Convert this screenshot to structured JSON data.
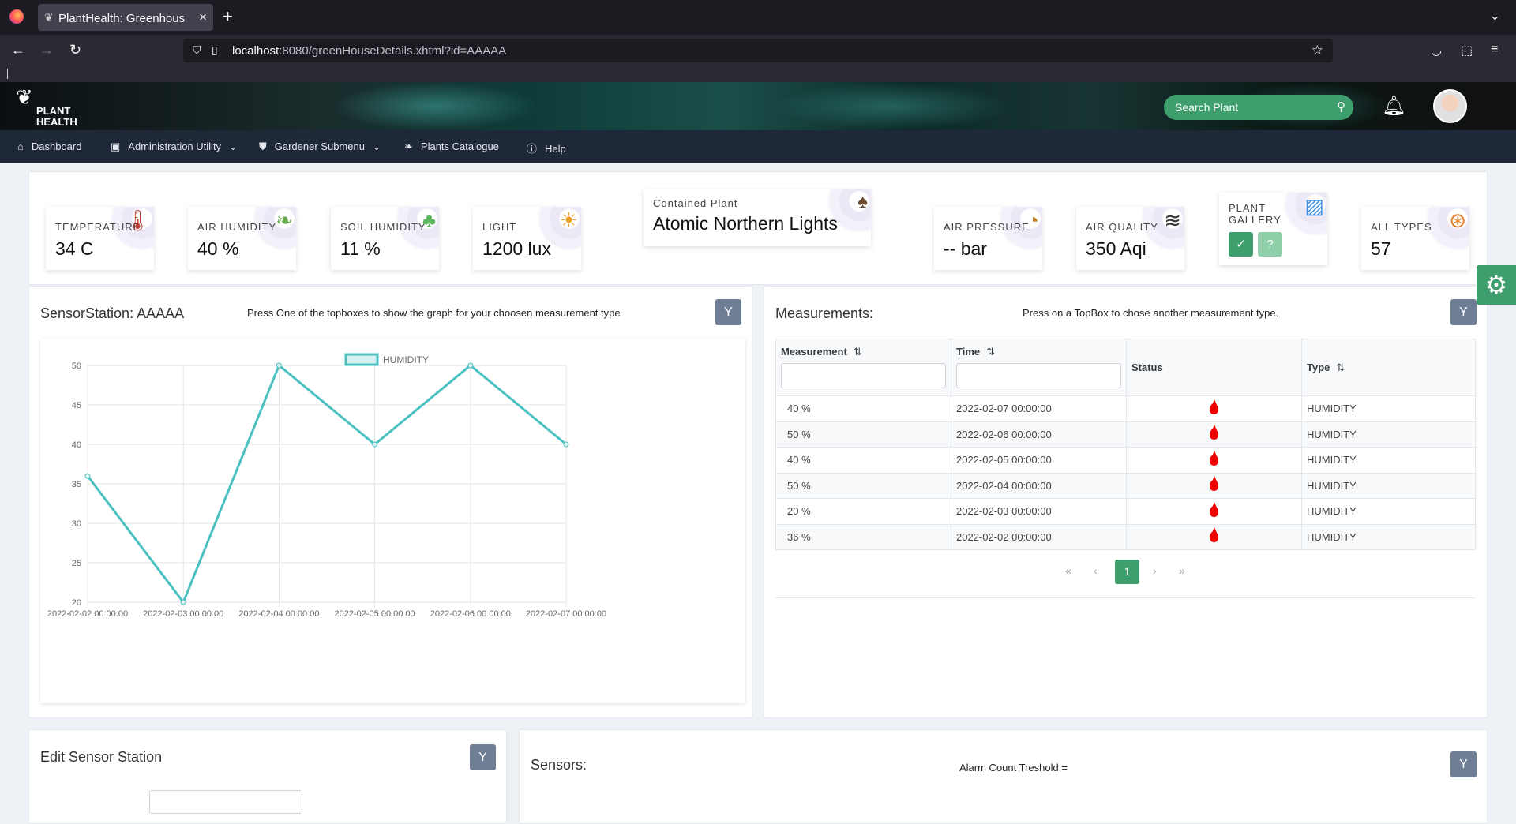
{
  "browser": {
    "tab_title": "PlantHealth: Greenhous",
    "url_host": "localhost",
    "url_rest": ":8080/greenHouseDetails.xhtml?id=AAAAA"
  },
  "header": {
    "logo_line1": "PLANT",
    "logo_line2": "HEALTH",
    "search_placeholder": "Search Plant"
  },
  "menu": {
    "items": [
      {
        "label": "Dashboard",
        "icon": "home-icon"
      },
      {
        "label": "Administration Utility",
        "icon": "briefcase-icon"
      },
      {
        "label": "Gardener Submenu",
        "icon": "shield-icon"
      },
      {
        "label": "Plants Catalogue",
        "icon": "leaf-icon"
      },
      {
        "label": "Help",
        "icon": "question-circle-icon"
      }
    ]
  },
  "topboxes": [
    {
      "label": "TEMPERATURE",
      "value": "34 C",
      "icon": "thermometer-icon"
    },
    {
      "label": "AIR HUMIDITY",
      "value": "40 %",
      "icon": "humid-leaf-icon"
    },
    {
      "label": "SOIL HUMIDITY",
      "value": "11 %",
      "icon": "watering-can-icon"
    },
    {
      "label": "LIGHT",
      "value": "1200 lux",
      "icon": "sun-icon"
    },
    {
      "label": "Contained Plant",
      "value": "Atomic Northern Lights",
      "icon": "potted-plant-icon"
    },
    {
      "label": "AIR PRESSURE",
      "value": "-- bar",
      "icon": "gauge-icon"
    },
    {
      "label": "AIR QUALITY",
      "value": "350 Aqi",
      "icon": "wind-icon"
    },
    {
      "label": "PLANT GALLERY",
      "value": "",
      "icon": "picture-icon"
    },
    {
      "label": "ALL TYPES",
      "value": "57",
      "icon": "globe-icon"
    }
  ],
  "gallery_buttons": {
    "confirm": "✓",
    "help": "?"
  },
  "sensor_panel": {
    "title": "SensorStation: AAAAA",
    "hint": "Press One of the topboxes to show the graph for your choosen measurement type"
  },
  "measure_panel": {
    "title": "Measurements:",
    "hint": "Press on a TopBox to chose another measurement type.",
    "columns": [
      "Measurement",
      "Time",
      "Status",
      "Type"
    ],
    "rows": [
      {
        "measurement": "40 %",
        "time": "2022-02-07 00:00:00",
        "type": "HUMIDITY"
      },
      {
        "measurement": "50 %",
        "time": "2022-02-06 00:00:00",
        "type": "HUMIDITY"
      },
      {
        "measurement": "40 %",
        "time": "2022-02-05 00:00:00",
        "type": "HUMIDITY"
      },
      {
        "measurement": "50 %",
        "time": "2022-02-04 00:00:00",
        "type": "HUMIDITY"
      },
      {
        "measurement": "20 %",
        "time": "2022-02-03 00:00:00",
        "type": "HUMIDITY"
      },
      {
        "measurement": "36 %",
        "time": "2022-02-02 00:00:00",
        "type": "HUMIDITY"
      }
    ],
    "pager": {
      "first": "«",
      "prev": "‹",
      "page": "1",
      "next": "›",
      "last": "»"
    }
  },
  "edit_panel": {
    "title": "Edit Sensor Station"
  },
  "sensors_panel": {
    "title": "Sensors:",
    "hint": "Alarm Count Treshold ="
  },
  "chart_data": {
    "type": "line",
    "x": [
      "2022-02-02 00:00:00",
      "2022-02-03 00:00:00",
      "2022-02-04 00:00:00",
      "2022-02-05 00:00:00",
      "2022-02-06 00:00:00",
      "2022-02-07 00:00:00"
    ],
    "series": [
      {
        "name": "HUMIDITY",
        "values": [
          36,
          20,
          50,
          40,
          50,
          40
        ],
        "color": "#4bc0c0"
      }
    ],
    "yticks": [
      20,
      25,
      30,
      35,
      40,
      45,
      50
    ],
    "ylim": [
      20,
      50
    ],
    "grid": true,
    "legend": "top-center"
  },
  "colors": {
    "accent": "#3e9e6e",
    "menubar": "#1e2838",
    "icon_button": "#6f7d95"
  }
}
